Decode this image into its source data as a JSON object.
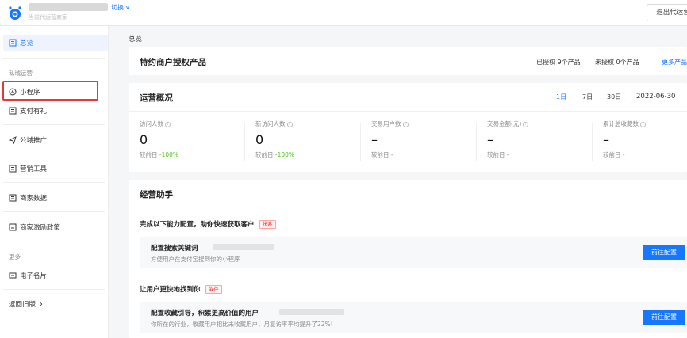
{
  "header": {
    "account_subtitle": "当前代运营商家",
    "switch_label": "切换",
    "exit_label": "退出代运营"
  },
  "sidebar": {
    "overview": "总览",
    "section_private": "私域运营",
    "mini_program": "小程序",
    "pay_gift": "支付有礼",
    "public_promo": "公域推广",
    "marketing_tools": "营销工具",
    "merchant_data": "商家数据",
    "incentive_policy": "商家激励政策",
    "section_more": "更多",
    "business_card": "电子名片",
    "back_old": "返回旧版",
    "back_old_chevron": "›"
  },
  "breadcrumb": "总览",
  "auth_card": {
    "title": "特约商户授权产品",
    "authorized": "已授权  9个产品",
    "unauthorized": "未授权  0个产品",
    "more": "更多产品"
  },
  "ops_card": {
    "title": "运营概况",
    "ranges": [
      "1日",
      "7日",
      "30日"
    ],
    "active_range": "1日",
    "date": "2022-06-30",
    "compare_label": "较前日",
    "metrics": [
      {
        "label": "访问人数",
        "value": "0",
        "delta": "-100%"
      },
      {
        "label": "新访问人数",
        "value": "0",
        "delta": "-100%"
      },
      {
        "label": "交易用户数",
        "value": "–",
        "delta": "-"
      },
      {
        "label": "交易金额(元)",
        "value": "–",
        "delta": "-"
      },
      {
        "label": "累计总收藏数",
        "value": "–",
        "delta": "-"
      }
    ]
  },
  "assist_card": {
    "title": "经营助手",
    "group1": {
      "title": "完成以下能力配置，助你快速获取客户",
      "tag": "获客",
      "task_name": "配置搜索关键词",
      "task_desc": "方便用户在支付宝搜到你的小程序",
      "button": "前往配置"
    },
    "group2": {
      "title": "让用户更快地找到你",
      "tag": "留存",
      "task_name": "配置收藏引导，积累更高价值的用户",
      "task_desc": "你所在的行业，收藏用户相比未收藏用户，月复访率平均提升了22%!",
      "button": "前往配置"
    }
  },
  "colors": {
    "accent": "#1677ff",
    "highlight": "#e53935",
    "positive": "#52c41a"
  }
}
